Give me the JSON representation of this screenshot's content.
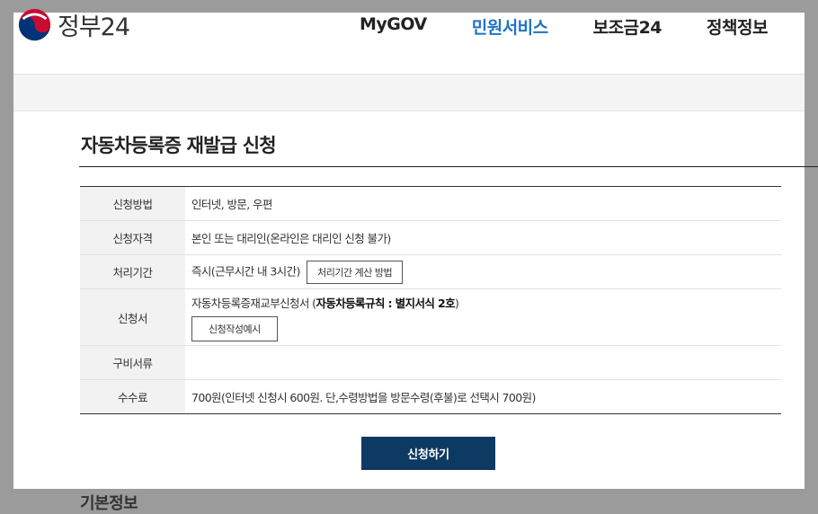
{
  "header": {
    "logo_text": "정부24",
    "nav": [
      "MyGOV",
      "민원서비스",
      "보조금24",
      "정책정보"
    ],
    "nav_active_index": 1,
    "nav_more": "ㅍ"
  },
  "page": {
    "title": "자동차등록증 재발급 신청"
  },
  "info_rows": {
    "method": {
      "label": "신청방법",
      "value": "인터넷, 방문, 우편"
    },
    "eligibility": {
      "label": "신청자격",
      "value": "본인 또는 대리인(온라인은 대리인 신청 불가)"
    },
    "period": {
      "label": "처리기간",
      "value": "즉시(근무시간 내 3시간)",
      "button": "처리기간 계산 방법"
    },
    "form": {
      "label": "신청서",
      "value_prefix": "자동차등록증재교부신청서 (",
      "value_bold": "자동차등록규칙 : 별지서식 2호",
      "value_suffix": ")",
      "button": "신청작성예시"
    },
    "documents": {
      "label": "구비서류",
      "value": ""
    },
    "fee": {
      "label": "수수료",
      "value": "700원(인터넷 신청시 600원. 단,수령방법을 방문수령(후불)로 선택시 700원)"
    }
  },
  "apply_button": "신청하기",
  "next_section_title": "기본정보",
  "colors": {
    "accent": "#1e73c9",
    "primary_button": "#0d3a63",
    "header_bg": "#f2f2f2"
  }
}
